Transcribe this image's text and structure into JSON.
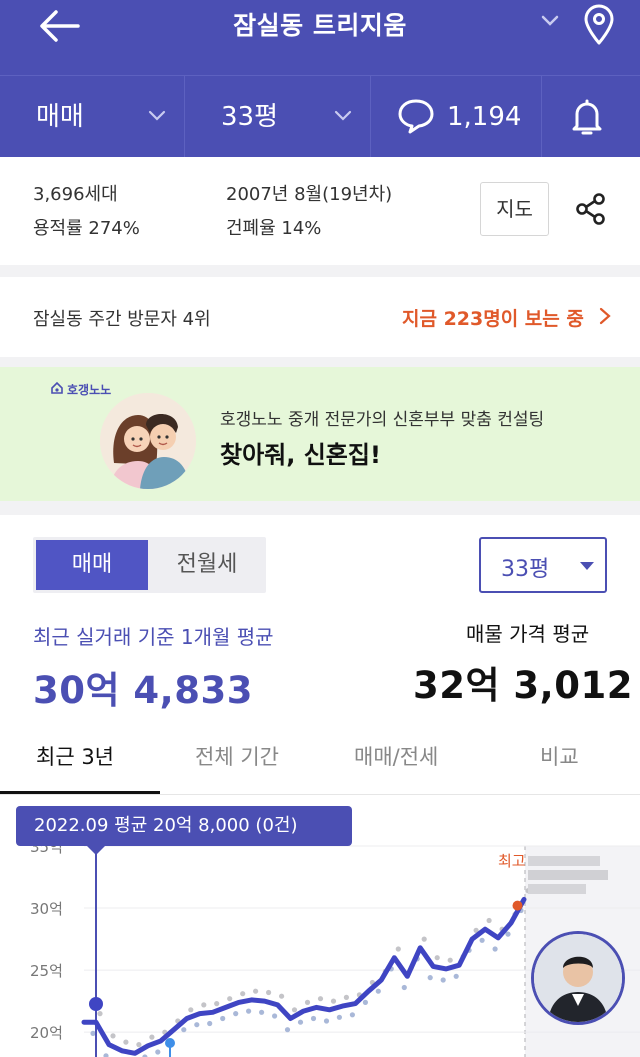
{
  "header": {
    "title": "잠실동 트리지움",
    "back_icon": "arrow-left-icon",
    "dropdown_icon": "chevron-down-icon",
    "location_icon": "map-pin-icon"
  },
  "subbar": {
    "deal_type": "매매",
    "size": "33평",
    "comments": "1,194",
    "comment_icon": "speech-bubble-icon",
    "bell_icon": "bell-icon"
  },
  "info": {
    "households": "3,696세대",
    "far": "용적률 274%",
    "built": "2007년 8월(19년차)",
    "bcr": "건폐율 14%",
    "map_button": "지도",
    "share_icon": "share-icon"
  },
  "visitors": {
    "rank_text": "잠실동 주간 방문자 4위",
    "live_text": "지금 223명이 보는 중",
    "live_color": "#e0592a"
  },
  "banner": {
    "brand": "호갱노노",
    "subtitle": "호갱노노 중개 전문가의 신혼부부 맞춤 컨설팅",
    "title": "찾아줘, 신혼집!"
  },
  "price": {
    "seg_on": "매매",
    "seg_off": "전월세",
    "size_select": "33평",
    "avg_label": "최근 실거래 기준 1개월 평균",
    "avg_value": "30억 4,833",
    "listing_label": "매물 가격 평균",
    "listing_value": "32억 3,012",
    "accent": "#4b4fb3"
  },
  "tabs": [
    {
      "label": "최근 3년"
    },
    {
      "label": "전체 기간"
    },
    {
      "label": "매매/전세"
    },
    {
      "label": "비교"
    }
  ],
  "tooltip": "2022.09 평균 20억 8,000 (0건)",
  "chart_data": {
    "type": "line",
    "y_ticks": [
      "35억",
      "30억",
      "25억",
      "20억"
    ],
    "ylim": [
      18,
      35
    ],
    "marker_label": "최고",
    "series": [
      {
        "values": [
          20.8,
          19.0,
          18.5,
          18.3,
          18.9,
          19.3,
          20.2,
          21.1,
          21.5,
          21.6,
          22.0,
          22.4,
          22.6,
          22.5,
          22.2,
          21.1,
          21.7,
          22.0,
          21.8,
          22.1,
          22.3,
          23.3,
          24.2,
          26.0,
          24.5,
          26.8,
          25.3,
          25.1,
          25.4,
          27.5,
          28.3,
          27.6,
          28.8,
          30.7
        ]
      }
    ]
  }
}
